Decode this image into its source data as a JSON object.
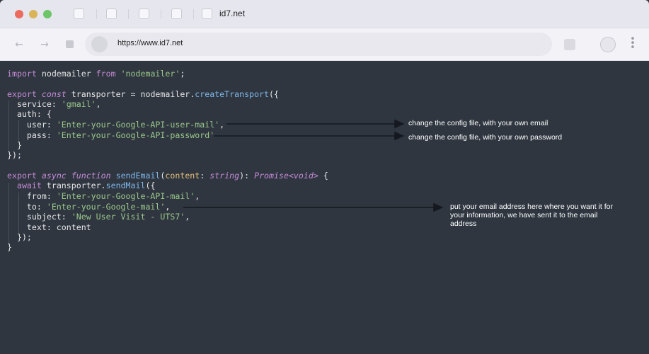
{
  "browser": {
    "tab_title": "id7.net",
    "url": "https://www.id7.net",
    "back_icon": "arrow-left-icon",
    "forward_icon": "arrow-right-icon",
    "stop_icon": "stop-icon",
    "menu_icon": "kebab-menu-icon"
  },
  "code": {
    "l1": [
      "import",
      " nodemailer ",
      "from",
      " ",
      "'nodemailer'",
      ";"
    ],
    "l3": [
      "export",
      " ",
      "const",
      " transporter = nodemailer.",
      "createTransport",
      "({"
    ],
    "l4": [
      "  service: ",
      "'gmail'",
      ","
    ],
    "l5": [
      "  auth: {"
    ],
    "l6": [
      "    user: ",
      "'Enter-your-Google-API-user-mail'",
      ","
    ],
    "l7": [
      "    pass: ",
      "'Enter-your-Google-API-password'"
    ],
    "l8": [
      "  }"
    ],
    "l9": [
      "});"
    ],
    "l11": [
      "export",
      " ",
      "async",
      " ",
      "function",
      " ",
      "sendEmail",
      "(",
      "content",
      ": ",
      "string",
      "): ",
      "Promise<void>",
      " {"
    ],
    "l12": [
      "  ",
      "await",
      " transporter.",
      "sendMail",
      "({"
    ],
    "l13": [
      "    from: ",
      "'Enter-your-Google-API-mail'",
      ","
    ],
    "l14": [
      "    to: ",
      "'Enter-your-Google-mail'",
      ","
    ],
    "l15": [
      "    subject: ",
      "'New User Visit - UTS7'",
      ","
    ],
    "l16": [
      "    text: content"
    ],
    "l17": [
      "  });"
    ],
    "l18": [
      "}"
    ]
  },
  "annotations": {
    "user_note": "change the config file, with your own email",
    "pass_note": "change the config file, with your own password",
    "to_note_1": "put your email address here where you want it for",
    "to_note_2": "your information, we have sent it to the email",
    "to_note_3": "address"
  },
  "colors": {
    "background": "#2f3640",
    "keyword": "#c58bd6",
    "string": "#9bc88a",
    "function": "#7eb6e8",
    "param": "#e5c07b"
  }
}
